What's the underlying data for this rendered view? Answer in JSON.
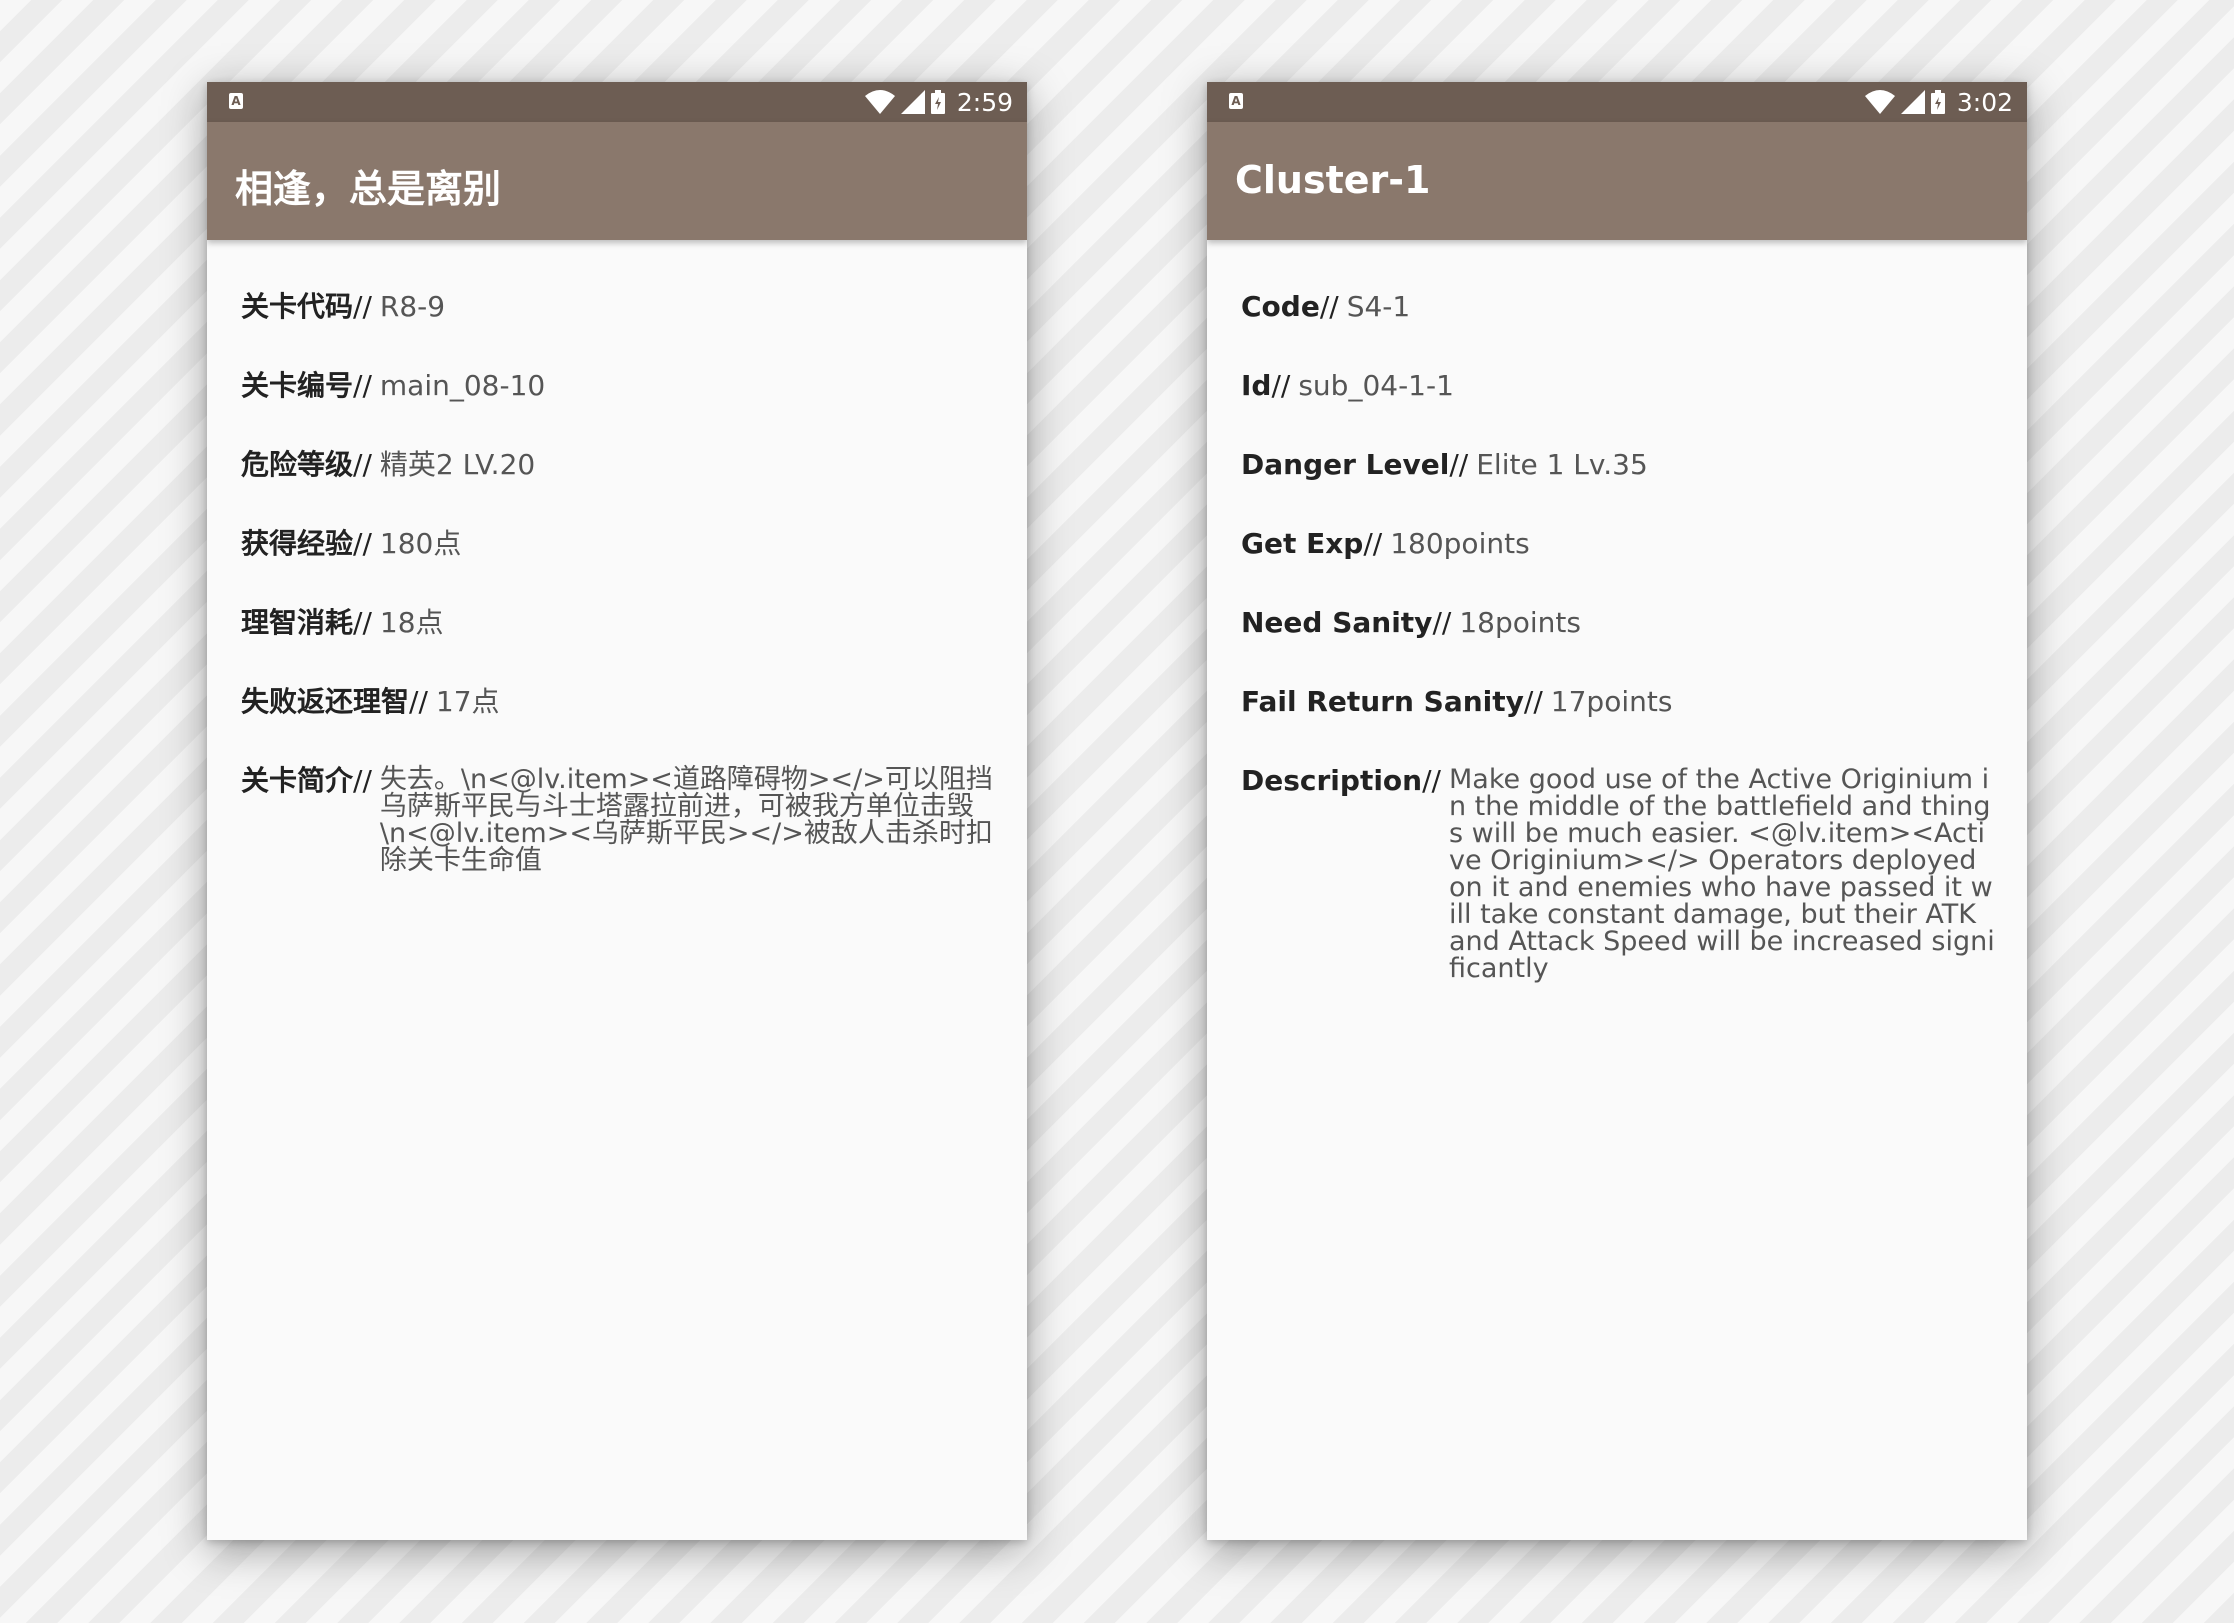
{
  "screens": [
    {
      "status": {
        "time": "2:59",
        "notification_icon": "a-notification-icon"
      },
      "title": "相逢，总是离别",
      "separator": "//",
      "fields": [
        {
          "label": "关卡代码",
          "value": "R8-9"
        },
        {
          "label": "关卡编号",
          "value": "main_08-10"
        },
        {
          "label": "危险等级",
          "value": "精英2 LV.20"
        },
        {
          "label": "获得经验",
          "value": "180点"
        },
        {
          "label": "理智消耗",
          "value": "18点"
        },
        {
          "label": "失败返还理智",
          "value": "17点"
        },
        {
          "label": "关卡简介",
          "value": "失去。\\n<@lv.item><道路障碍物></>可以阻挡乌萨斯平民与斗士塔露拉前进，可被我方单位击毁\\n<@lv.item><乌萨斯平民></>被敌人击杀时扣除关卡生命值"
        }
      ]
    },
    {
      "status": {
        "time": "3:02",
        "notification_icon": "a-notification-icon"
      },
      "title": "Cluster-1",
      "separator": "//",
      "fields": [
        {
          "label": "Code",
          "value": "S4-1"
        },
        {
          "label": "Id",
          "value": "sub_04-1-1"
        },
        {
          "label": "Danger Level",
          "value": "Elite 1 Lv.35"
        },
        {
          "label": "Get Exp",
          "value": "180points"
        },
        {
          "label": "Need Sanity",
          "value": "18points"
        },
        {
          "label": "Fail Return Sanity",
          "value": "17points"
        },
        {
          "label": "Description",
          "value": "Make good use of the Active Originium in the middle of the battlefield and things will be much easier. <@lv.item><Active Originium></> Operators deployed on it and enemies who have passed it will take constant damage, but their ATK and Attack Speed will be increased significantly"
        }
      ]
    }
  ],
  "colors": {
    "status_bar": "#6d5d53",
    "app_bar": "#8a786c",
    "background": "#fafafa"
  }
}
